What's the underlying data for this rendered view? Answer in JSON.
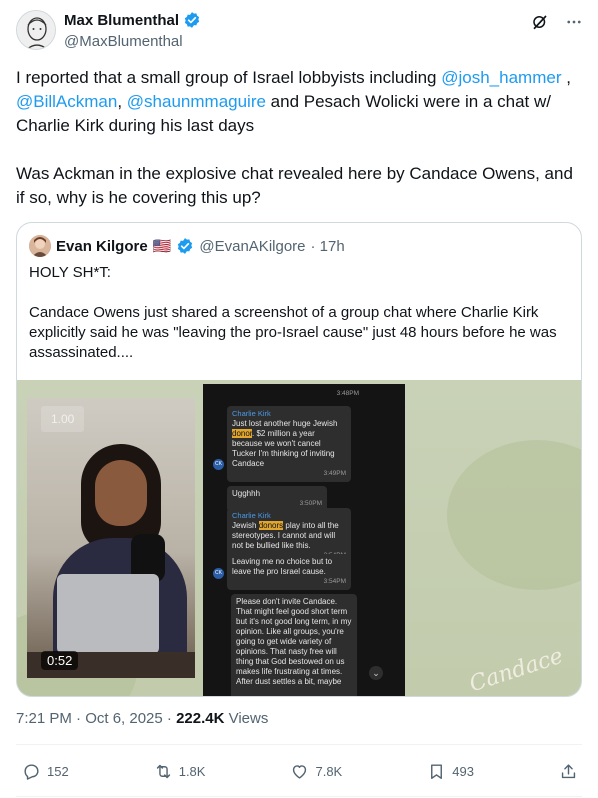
{
  "author": {
    "name": "Max Blumenthal",
    "handle": "@MaxBlumenthal"
  },
  "post": {
    "part1_a": "I reported that a small group of Israel lobbyists including ",
    "mention1": "@josh_hammer",
    "part1_b": " ,",
    "mention2": "@BillAckman",
    "part1_c": ", ",
    "mention3": "@shaunmmaguire",
    "part1_d": " and Pesach Wolicki were in a chat w/ Charlie Kirk during his last days",
    "part2": "Was Ackman in the explosive chat revealed here by Candace Owens, and if so, why is he covering this up?"
  },
  "quote": {
    "name": "Evan Kilgore",
    "flag": "🇺🇸",
    "handle": "@EvanAKilgore",
    "time": "· 17h",
    "line1": "HOLY SH*T:",
    "line2": "Candace Owens just shared a screenshot of a group chat where Charlie Kirk explicitly said he was \"leaving the pro-Israel cause\" just 48 hours before he was assassinated....",
    "video": {
      "speed": "1.00",
      "duration": "0:52",
      "signature": "Candace"
    },
    "chat": {
      "stamp_top": "3:48PM",
      "sender": "Charlie Kirk",
      "avatar_initials": "CK",
      "msg1_a": "Just lost another huge Jewish ",
      "msg1_hl": "donor",
      "msg1_b": ". $2 million a year because we won't cancel Tucker I'm thinking of inviting Candace",
      "msg1_time": "3:49PM",
      "msg2": "Ugghhh",
      "msg2_time": "3:50PM",
      "msg3_a": "Jewish ",
      "msg3_hl": "donors",
      "msg3_b": " play into all the stereotypes. I cannot and will not be bullied like this.",
      "msg3_time": "3:54PM",
      "msg4": "Leaving me no choice but to leave the pro Israel cause.",
      "msg4_time": "3:54PM",
      "msg5": "Please don't invite Candace. That might feel good short term but it's not good long term, in my opinion. Like all groups, you're going to get wide variety of opinions. That nasty free will thing that God bestowed on us makes life frustrating at times. After dust settles a bit, maybe"
    }
  },
  "meta": {
    "time": "7:21 PM · Oct 6, 2025 · ",
    "views": "222.4K",
    "views_label": " Views"
  },
  "actions": {
    "replies": "152",
    "reposts": "1.8K",
    "likes": "7.8K",
    "bookmarks": "493"
  },
  "colors": {
    "accent": "#1d9bf0",
    "text": "#0f1419",
    "muted": "#536471",
    "highlight": "#e0a62e"
  }
}
